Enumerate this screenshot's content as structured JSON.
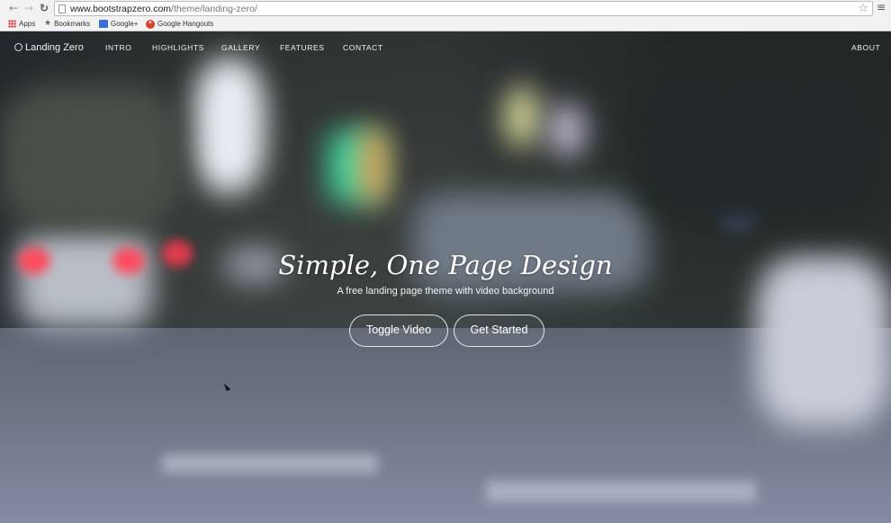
{
  "browser": {
    "url_host": "www.bootstrapzero.com",
    "url_path": "/theme/landing-zero/",
    "icons": {
      "back": "back-arrow-icon",
      "forward": "forward-arrow-icon",
      "reload": "reload-icon",
      "star": "star-icon",
      "menu": "hamburger-menu-icon"
    },
    "bookmarks": [
      {
        "label": "Apps",
        "icon": "apps-grid-icon"
      },
      {
        "label": "Bookmarks",
        "icon": "star-icon"
      },
      {
        "label": "Google+",
        "icon": "google-plus-icon"
      },
      {
        "label": "Google Hangouts",
        "icon": "hangouts-icon"
      }
    ]
  },
  "site": {
    "brand": "Landing Zero",
    "nav": [
      "INTRO",
      "HIGHLIGHTS",
      "GALLERY",
      "FEATURES",
      "CONTACT"
    ],
    "nav_right": "ABOUT",
    "headline": "Simple, One Page Design",
    "tagline": "A free landing page theme with video background",
    "buttons": {
      "toggle": "Toggle Video",
      "start": "Get Started"
    }
  },
  "colors": {
    "text": "#ffffff",
    "chrome": "#f2f2f2"
  }
}
